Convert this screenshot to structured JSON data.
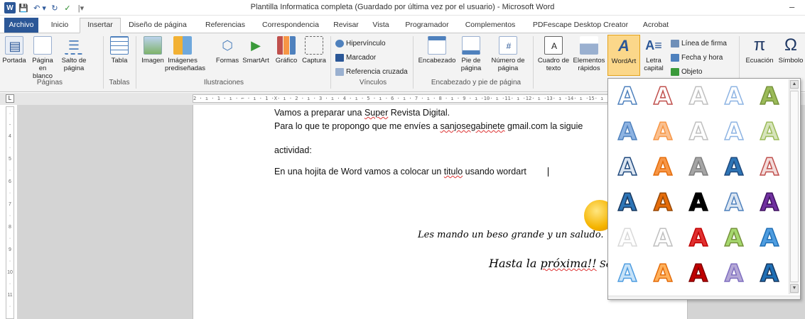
{
  "window": {
    "title": "Plantilla Informatica completa (Guardado por última vez por el usuario)  -  Microsoft Word",
    "minimize": "–",
    "qat": {
      "logo": "W",
      "save": "💾",
      "undo": "↶ ▾",
      "redo": "↻",
      "spell": "✓",
      "customize": "|▾"
    }
  },
  "tabs": [
    "Archivo",
    "Inicio",
    "Insertar",
    "Diseño de página",
    "Referencias",
    "Correspondencia",
    "Revisar",
    "Vista",
    "Programador",
    "Complementos",
    "PDFescape Desktop Creator",
    "Acrobat"
  ],
  "active_tab": "Insertar",
  "ribbon": {
    "paginas": {
      "portada": "Portada",
      "pagina_en_blanco": "Página en blanco",
      "salto_de_pagina": "Salto de página",
      "group": "Páginas"
    },
    "tablas": {
      "tabla": "Tabla",
      "group": "Tablas"
    },
    "ilustraciones": {
      "imagen": "Imagen",
      "imagenes_prediseñadas": "Imágenes prediseñadas",
      "formas": "Formas",
      "smartart": "SmartArt",
      "grafico": "Gráfico",
      "captura": "Captura",
      "group": "Ilustraciones"
    },
    "vinculos": {
      "hipervinculo": "Hipervínculo",
      "marcador": "Marcador",
      "referencia_cruzada": "Referencia cruzada",
      "group": "Vínculos"
    },
    "encabezado": {
      "encabezado": "Encabezado",
      "pie_de_pagina": "Pie de página",
      "numero_de_pagina": "Número de página",
      "group": "Encabezado y pie de página"
    },
    "texto": {
      "cuadro_de_texto": "Cuadro de texto",
      "elementos_rapidos": "Elementos rápidos",
      "wordart": "WordArt",
      "letra_capital": "Letra capital",
      "linea_de_firma": "Línea de firma",
      "fecha_y_hora": "Fecha y hora",
      "objeto": "Objeto"
    },
    "simbolos": {
      "ecuacion": "Ecuación",
      "simbolo": "Símbolo",
      "pi": "π",
      "omega": "Ω"
    }
  },
  "ruler": {
    "corner": "L",
    "h_marks": "2 · ı · 1 · ı · ⌐ · ı · 1 ·X· ı · 2 · ı · 3 · ı · 4 · ı · 5 · ı · 6 · ı · 7 · ı · 8 · ı · 9 · ı ·10· ı ·11· ı ·12· ı ·13· ı ·14· ı ·15· ı",
    "v_marks": [
      "·",
      "-",
      "4",
      "·",
      "5",
      "·",
      "6",
      "·",
      "7",
      "·",
      "8",
      "·",
      "9",
      "·",
      "10",
      "·",
      "11",
      "·"
    ]
  },
  "document": {
    "line1_pre": "Vamos a preparar una ",
    "line1_err": "Super",
    "line1_post": " Revista Digital.",
    "line2_pre": "Para lo que te propongo  que me envíes  a ",
    "line2_err": "sanjosegabinete",
    "line2_post": "  gmail.com la siguie",
    "line3": "actividad:",
    "line4_pre": "En una hojita de Word vamos a colocar un ",
    "line4_err": "titulo",
    "line4_post": " usando wordart",
    "closing1": "Les mando un beso grande y un saludo.",
    "closing2_pre": "Hasta la ",
    "closing2_err": "próxima!!",
    "closing2_post": "  Se"
  },
  "wordart_gallery": {
    "glyph": "A",
    "styles": [
      [
        "#ffffff|#4f81bd",
        "#ffffff|#c0504d",
        "#ffffff|#bfbfbf",
        "#ffffff|#8eb4e3",
        "#9bbb59|#77933c"
      ],
      [
        "#8db3e2|#4f81bd",
        "#fac08f|#f79646",
        "#ffffff|#bfbfbf",
        "#ffffff|#8eb4e3",
        "#d7e4bc|#9bbb59"
      ],
      [
        "#dbe5f1|#1f497d",
        "#f79646|#e46c0a",
        "#a5a5a5|#7f7f7f",
        "#2e75b6|#1f497d",
        "#f2dcdb|#c0504d"
      ],
      [
        "#2e75b6|#17375e",
        "#e46c0a|#974806",
        "#000000|#000000",
        "#dbe5f1|#4f81bd",
        "#7030a0|#3f1260"
      ],
      [
        "#ffffff|#d9d9d9",
        "#ffffff|#bfbfbf",
        "#e03030|#c00000",
        "#a6d86e|#76923c",
        "#4f9de0|#1f6fb5"
      ],
      [
        "#c6e2f8|#4f9de0",
        "#ffb05a|#e46c0a",
        "#c00000|#7f0000",
        "#b4a7d6|#7f6fc0",
        "#1f6fb5|#17375e"
      ]
    ]
  }
}
